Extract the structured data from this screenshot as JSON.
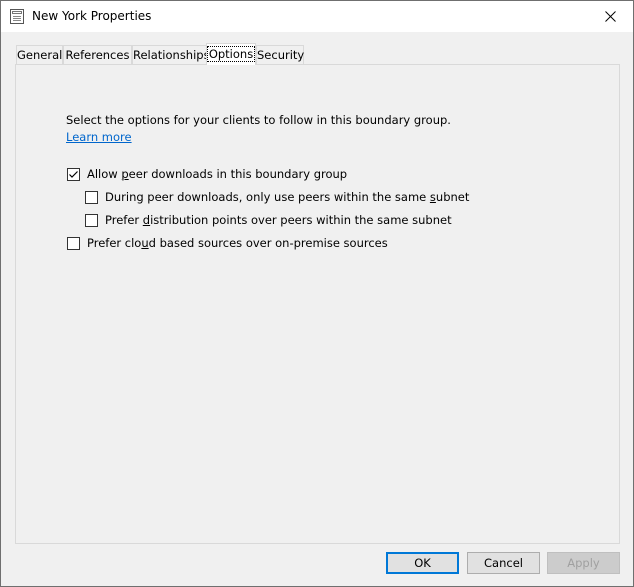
{
  "window": {
    "title": "New York Properties"
  },
  "tabs": [
    {
      "label": "General"
    },
    {
      "label": "References"
    },
    {
      "label": "Relationships"
    },
    {
      "label": "Options",
      "selected": true
    },
    {
      "label": "Security"
    }
  ],
  "options": {
    "description": "Select the options for your clients to follow in this boundary group.",
    "learn_more": "Learn more",
    "allow_peer": {
      "pre": "Allow ",
      "accel": "p",
      "post": "eer downloads in this boundary group",
      "checked": true
    },
    "subnet_only": {
      "pre": "During peer downloads, only use peers within the same ",
      "accel": "s",
      "post": "ubnet",
      "checked": false
    },
    "prefer_dp": {
      "pre": "Prefer ",
      "accel": "d",
      "post": "istribution points over peers within the same subnet",
      "checked": false
    },
    "prefer_cloud": {
      "pre": "Prefer clo",
      "accel": "u",
      "post": "d based sources over on-premise sources",
      "checked": false
    }
  },
  "buttons": {
    "ok": "OK",
    "cancel": "Cancel",
    "apply": "Apply"
  },
  "colors": {
    "link": "#0066cc",
    "default_button_border": "#0078d7"
  }
}
